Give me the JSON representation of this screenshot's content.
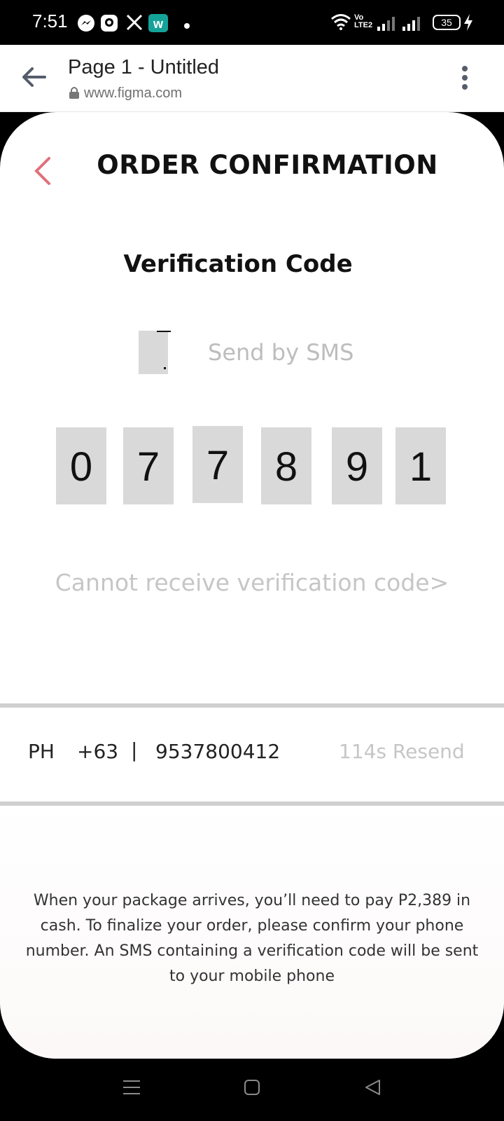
{
  "status_bar": {
    "time": "7:51",
    "battery": "35",
    "network_label": "Vo LTE2",
    "icons": [
      "messenger-icon",
      "app-icon",
      "x-icon",
      "w-app-icon",
      "dot-icon",
      "wifi-icon",
      "signal-icon",
      "signal-icon",
      "battery-icon",
      "charging-icon"
    ]
  },
  "browser": {
    "title": "Page 1 - Untitled",
    "url": "www.figma.com"
  },
  "page": {
    "title": "ORDER CONFIRMATION",
    "verification_heading": "Verification Code",
    "sms_label": "Send by SMS",
    "code_digits": [
      "0",
      "7",
      "7",
      "8",
      "9",
      "1"
    ],
    "cannot_receive": "Cannot receive verification code>",
    "phone": {
      "country": "PH",
      "dial_code": "+63",
      "separator": "|",
      "number": "9537800412",
      "resend": "114s Resend"
    },
    "footer_text": "When your package arrives, you’ll need to pay P2,389 in cash. To finalize your order, please confirm your phone number. An SMS containing a verification code will be sent to your mobile phone"
  },
  "colors": {
    "accent": "#e0707a",
    "box_gray": "#d9d9d9",
    "muted_text": "#bdbdbd"
  }
}
